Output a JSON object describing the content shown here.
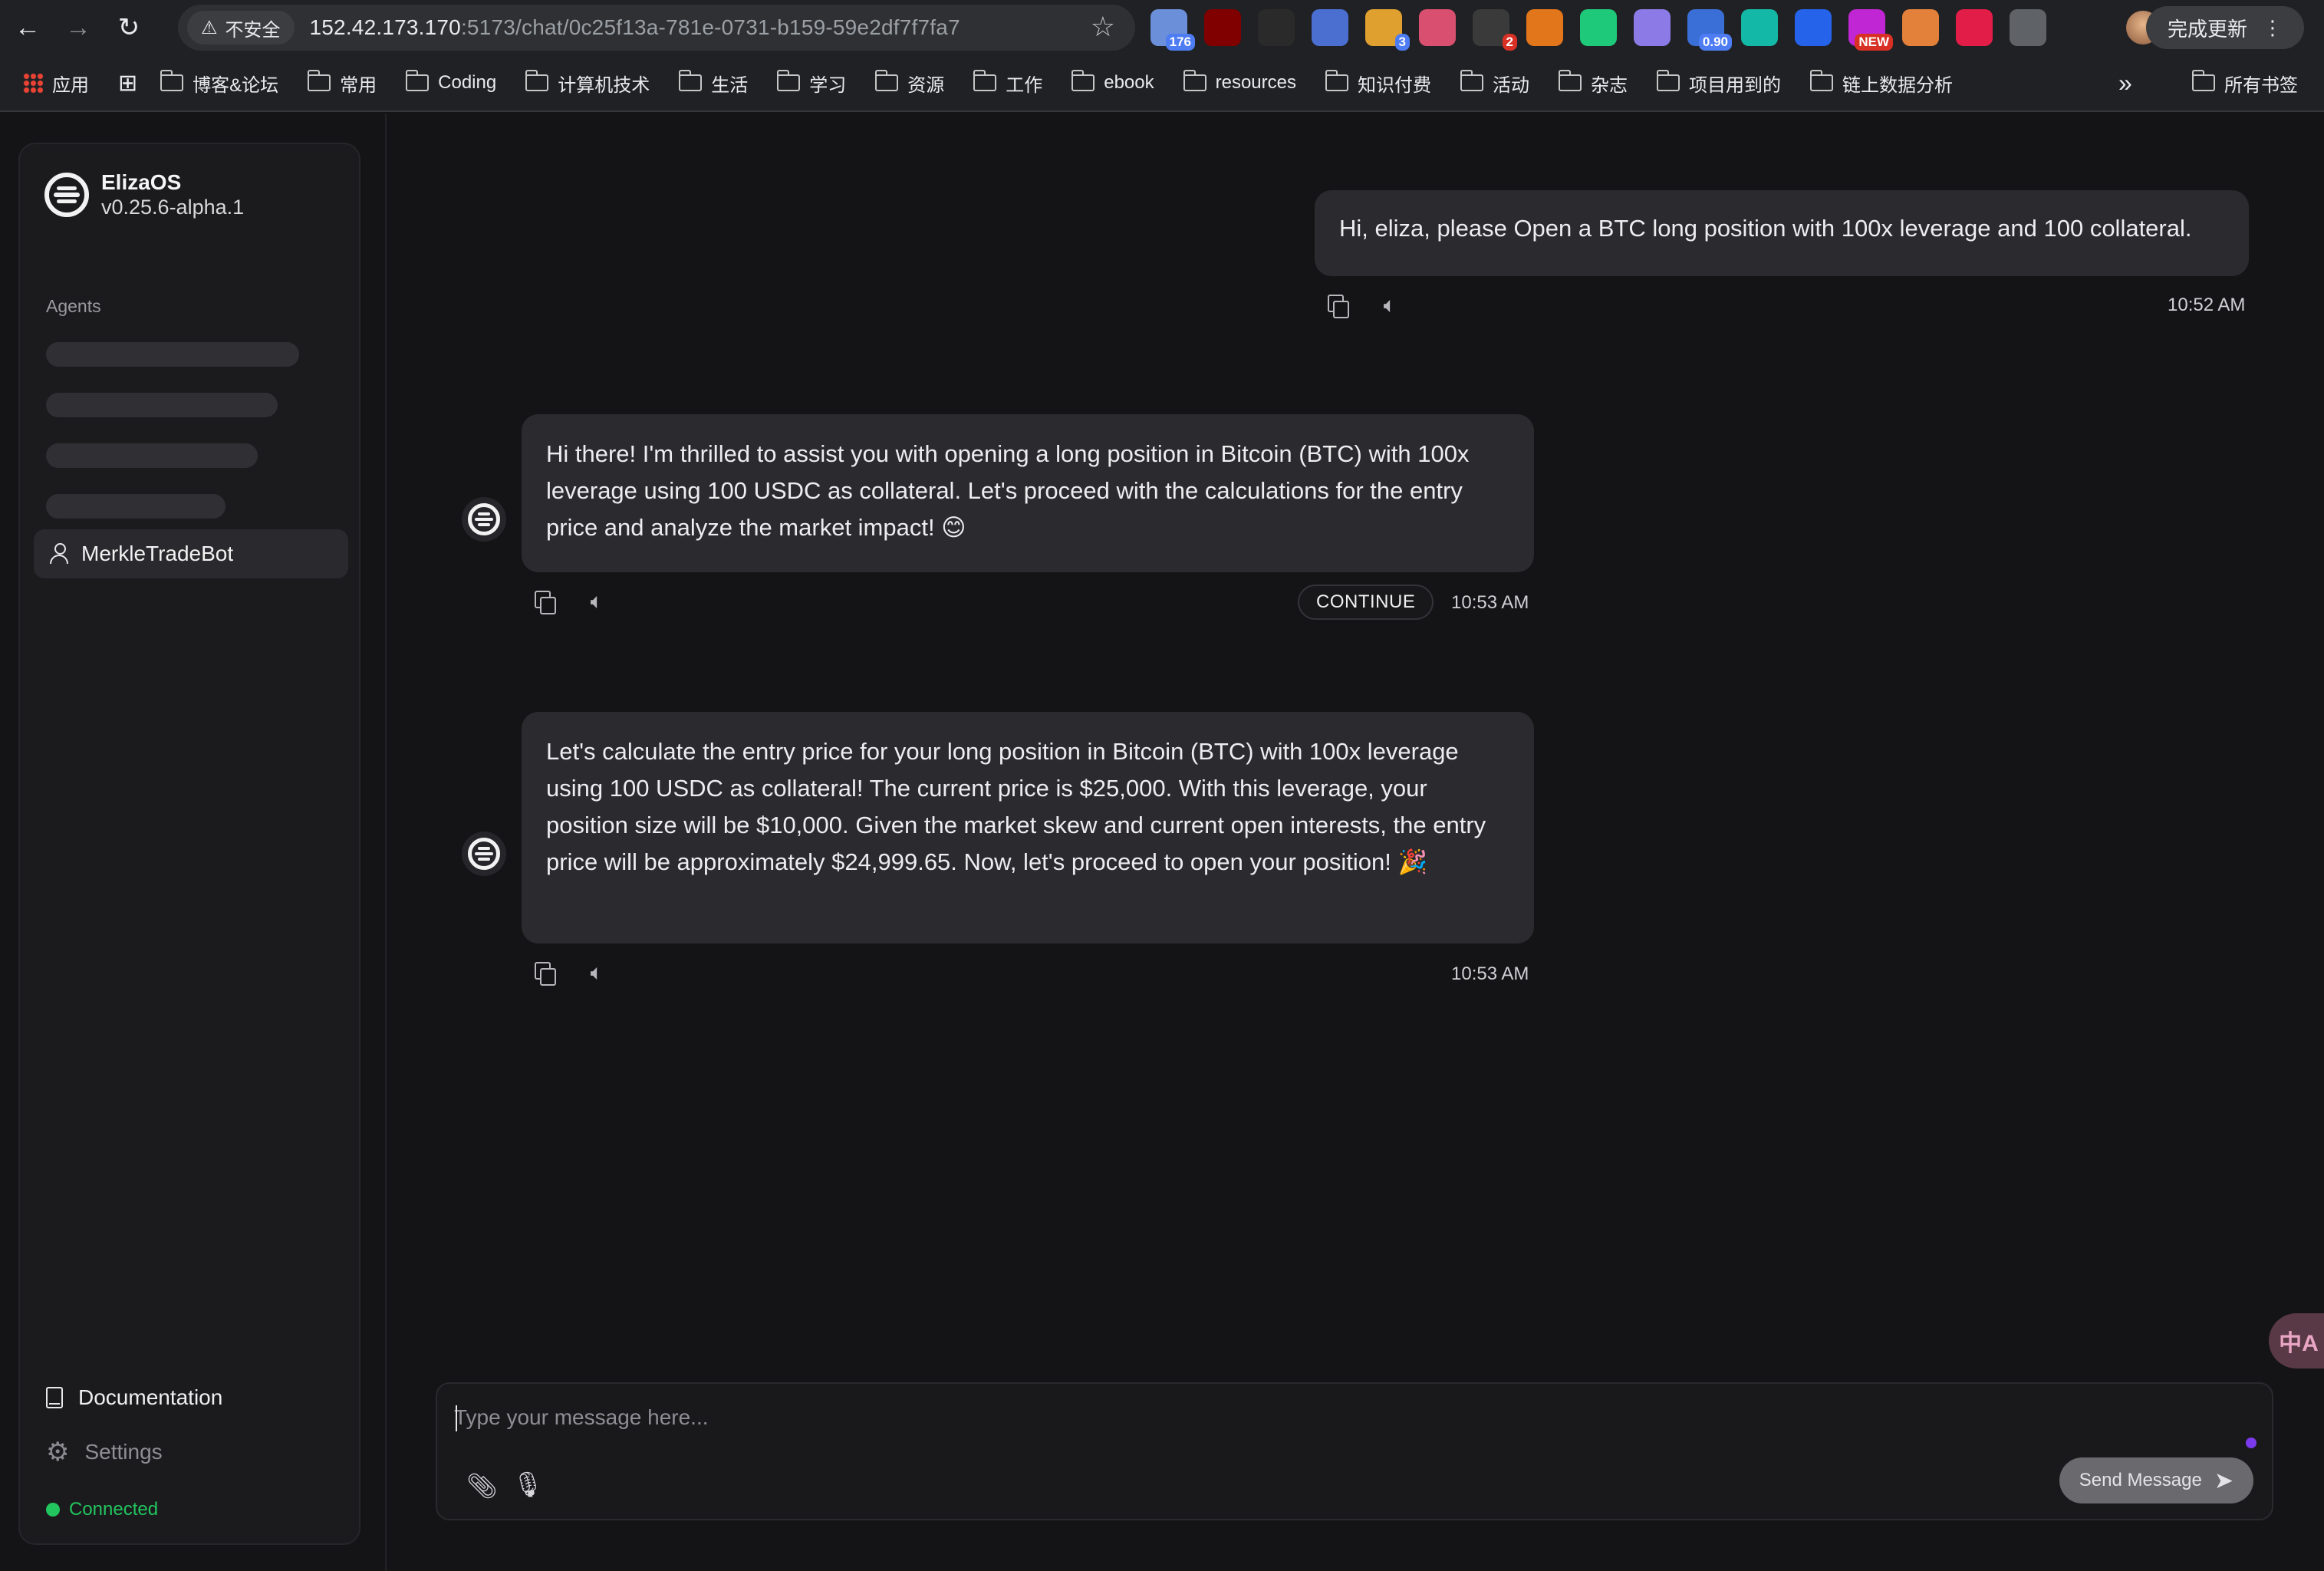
{
  "browser": {
    "back_icon": "←",
    "forward_icon": "→",
    "reload_icon": "↻",
    "security_label": "不安全",
    "url_host": "152.42.173.170",
    "url_rest": ":5173/chat/0c25f13a-781e-0731-b159-59e2df7f7fa7",
    "update_label": "完成更新",
    "extensions": [
      {
        "icon": "tv-icon",
        "badge": "176",
        "color": "#6b8fd8"
      },
      {
        "icon": "ublock-icon",
        "badge": "",
        "color": "#800000"
      },
      {
        "icon": "x-icon",
        "badge": "",
        "color": "#2a2a2a"
      },
      {
        "icon": "card-icon",
        "badge": "",
        "color": "#4a6fd1"
      },
      {
        "icon": "cat-icon",
        "badge": "3",
        "color": "#e0a030"
      },
      {
        "icon": "flower-icon",
        "badge": "",
        "color": "#d94f70"
      },
      {
        "icon": "screen-icon",
        "badge": "2",
        "color": "#3a3a3a"
      },
      {
        "icon": "fox-icon",
        "badge": "",
        "color": "#e2761b"
      },
      {
        "icon": "chart-icon",
        "badge": "",
        "color": "#1ec97a"
      },
      {
        "icon": "ghost-icon",
        "badge": "",
        "color": "#8c7ae6"
      },
      {
        "icon": "gauge-icon",
        "badge": "0.90",
        "color": "#3b6fd8"
      },
      {
        "icon": "uno-icon",
        "badge": "",
        "color": "#14b8a6"
      },
      {
        "icon": "calendar-icon",
        "badge": "",
        "color": "#2563eb"
      },
      {
        "icon": "gift-icon",
        "badge": "NEW",
        "color": "#c026d3"
      },
      {
        "icon": "s-icon",
        "badge": "",
        "color": "#e3813a"
      },
      {
        "icon": "pin-icon",
        "badge": "",
        "color": "#e11d48"
      },
      {
        "icon": "puzzle-icon",
        "badge": "",
        "color": "#5f6368"
      }
    ],
    "bookmarks": [
      {
        "label": "应用",
        "kind": "apps"
      },
      {
        "label": "",
        "kind": "grid"
      },
      {
        "label": "博客&论坛",
        "kind": "folder"
      },
      {
        "label": "常用",
        "kind": "folder"
      },
      {
        "label": "Coding",
        "kind": "folder"
      },
      {
        "label": "计算机技术",
        "kind": "folder"
      },
      {
        "label": "生活",
        "kind": "folder"
      },
      {
        "label": "学习",
        "kind": "folder"
      },
      {
        "label": "资源",
        "kind": "folder"
      },
      {
        "label": "工作",
        "kind": "folder"
      },
      {
        "label": "ebook",
        "kind": "folder"
      },
      {
        "label": "resources",
        "kind": "folder"
      },
      {
        "label": "知识付费",
        "kind": "folder"
      },
      {
        "label": "活动",
        "kind": "folder"
      },
      {
        "label": "杂志",
        "kind": "folder"
      },
      {
        "label": "项目用到的",
        "kind": "folder"
      },
      {
        "label": "链上数据分析",
        "kind": "folder"
      }
    ],
    "overflow_label": "»",
    "all_bookmarks_label": "所有书签"
  },
  "sidebar": {
    "brand_name": "ElizaOS",
    "brand_version": "v0.25.6-alpha.1",
    "agents_label": "Agents",
    "agent_name": "MerkleTradeBot",
    "documentation_label": "Documentation",
    "settings_label": "Settings",
    "status_label": "Connected",
    "status_color": "#22c55e"
  },
  "chat": {
    "messages": [
      {
        "role": "user",
        "text": "Hi, eliza, please Open a BTC long position with 100x leverage and 100 collateral.",
        "time": "10:52 AM"
      },
      {
        "role": "agent",
        "text": "Hi there! I'm thrilled to assist you with opening a long position in Bitcoin (BTC) with 100x leverage using 100 USDC as collateral. Let's proceed with the calculations for the entry price and analyze the market impact! 😊",
        "time": "10:53 AM",
        "action_label": "CONTINUE"
      },
      {
        "role": "agent",
        "text": "Let's calculate the entry price for your long position in Bitcoin (BTC) with 100x leverage using 100 USDC as collateral! The current price is $25,000. With this leverage, your position size will be $10,000. Given the market skew and current open interests, the entry price will be approximately $24,999.65. Now, let's proceed to open your position! 🎉",
        "time": "10:53 AM"
      }
    ],
    "input_placeholder": "Type your message here...",
    "send_label": "Send Message",
    "translate_label": "中A"
  }
}
